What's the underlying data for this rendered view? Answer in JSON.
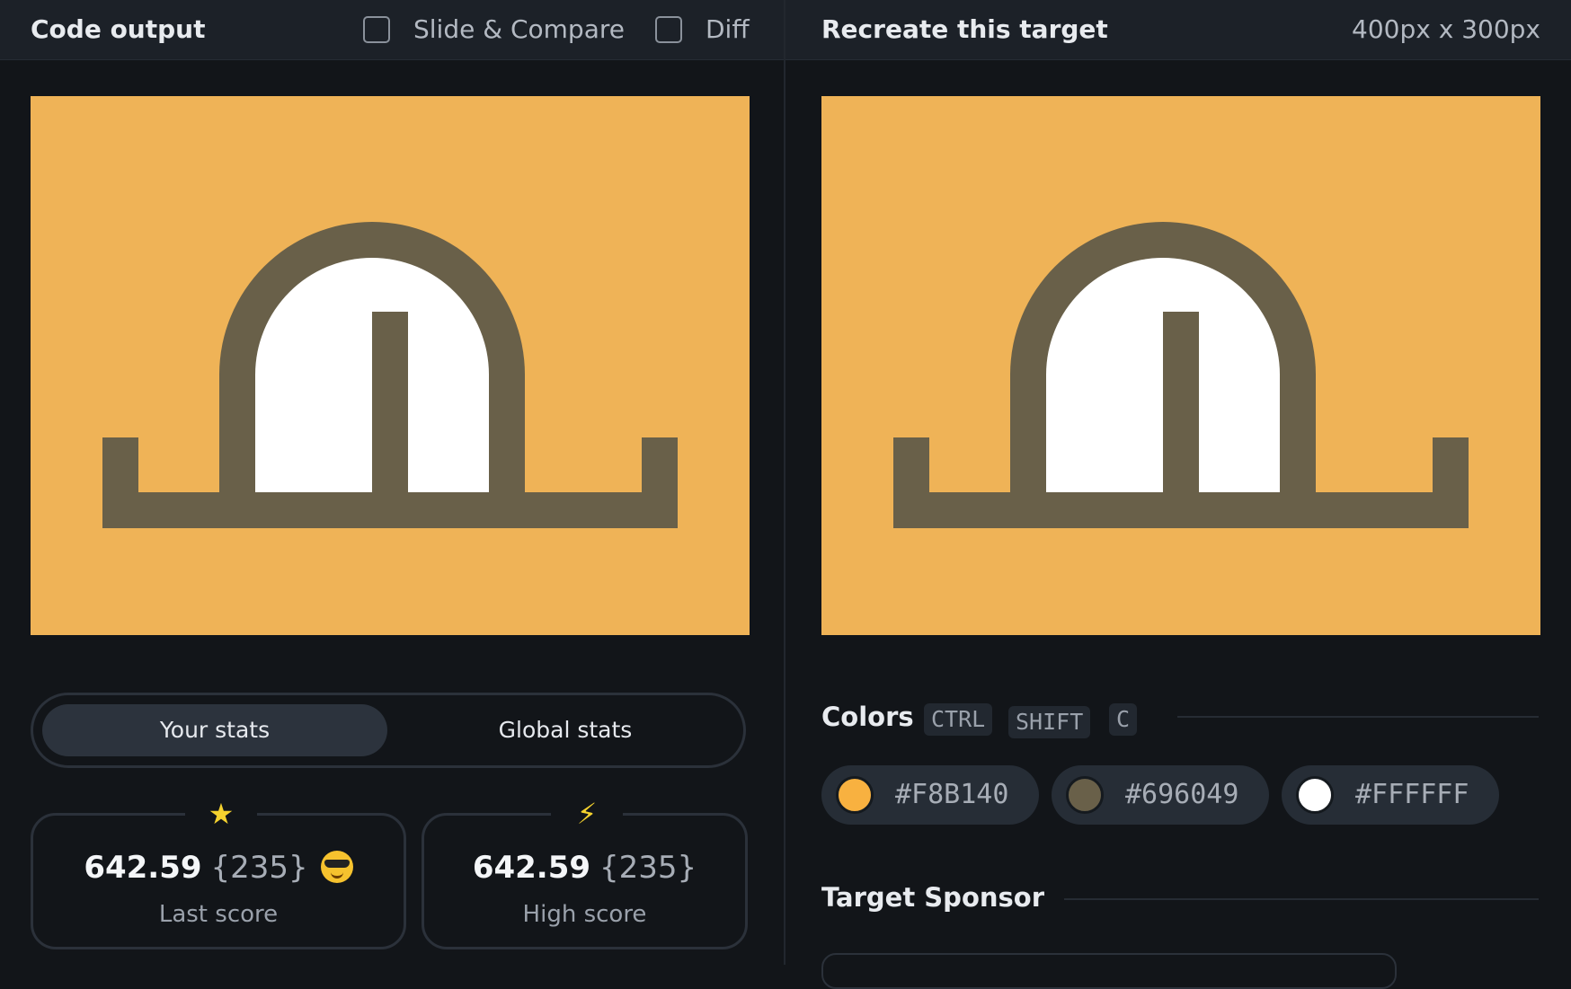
{
  "left_header": {
    "title": "Code output",
    "slide_compare_label": "Slide & Compare",
    "diff_label": "Diff"
  },
  "right_header": {
    "title": "Recreate this target",
    "size": "400px x 300px"
  },
  "stats_tabs": {
    "your_stats": "Your stats",
    "global_stats": "Global stats",
    "active": "Your stats"
  },
  "stats": {
    "last": {
      "icon": "star-icon",
      "value": "642.59",
      "count": "{235}",
      "label": "Last score",
      "emoji": "sunglasses-emoji"
    },
    "high": {
      "icon": "lightning-icon",
      "value": "642.59",
      "count": "{235}",
      "label": "High score"
    }
  },
  "colors_section": {
    "title": "Colors",
    "shortcut": [
      "CTRL",
      "SHIFT",
      "C"
    ],
    "swatches": [
      {
        "hex": "#F8B140",
        "label": "#F8B140"
      },
      {
        "hex": "#696049",
        "label": "#696049"
      },
      {
        "hex": "#FFFFFF",
        "label": "#FFFFFF"
      }
    ]
  },
  "sponsor_section": {
    "title": "Target Sponsor"
  },
  "theme": {
    "canvas_bg": "#EFB357",
    "shape_dark": "#696049",
    "shape_light": "#FFFFFF"
  }
}
